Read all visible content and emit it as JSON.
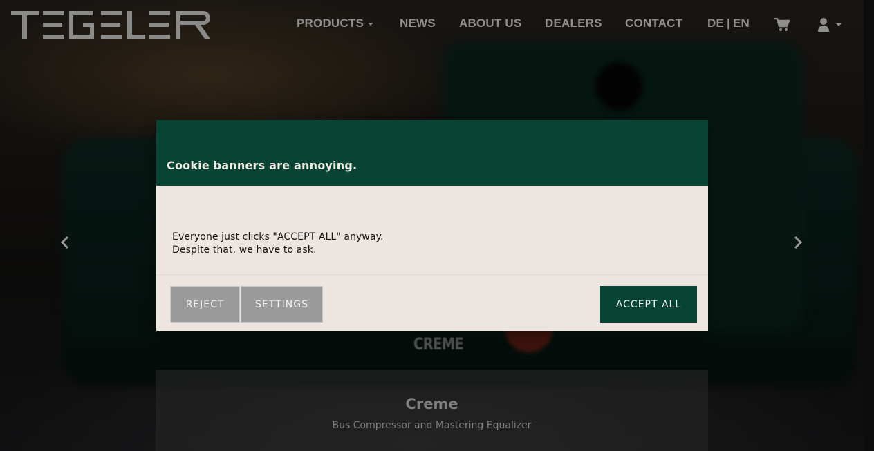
{
  "brand": {
    "logo_text": "TEGELER"
  },
  "nav": {
    "products": "PRODUCTS",
    "news": "NEWS",
    "about": "ABOUT US",
    "dealers": "DEALERS",
    "contact": "CONTACT",
    "lang_de": "DE",
    "lang_sep": "|",
    "lang_en": "EN"
  },
  "icons": {
    "cart": "shopping-cart-icon",
    "user": "user-icon",
    "prev": "chevron-left-icon",
    "next": "chevron-right-icon"
  },
  "slide": {
    "device_label": "CREME",
    "title": "Creme",
    "subtitle": "Bus Compressor and Mastering Equalizer"
  },
  "cookie": {
    "title": "Cookie banners are annoying.",
    "body_line1": "Everyone just clicks \"ACCEPT ALL\" anyway.",
    "body_line2": "Despite that, we have to ask.",
    "reject": "REJECT",
    "settings": "SETTINGS",
    "accept_all": "ACCEPT ALL"
  },
  "colors": {
    "modal_green": "#074433",
    "modal_bg": "#ede5df",
    "button_grey": "#9b9b9b",
    "nav_text": "#8f8f8d"
  }
}
